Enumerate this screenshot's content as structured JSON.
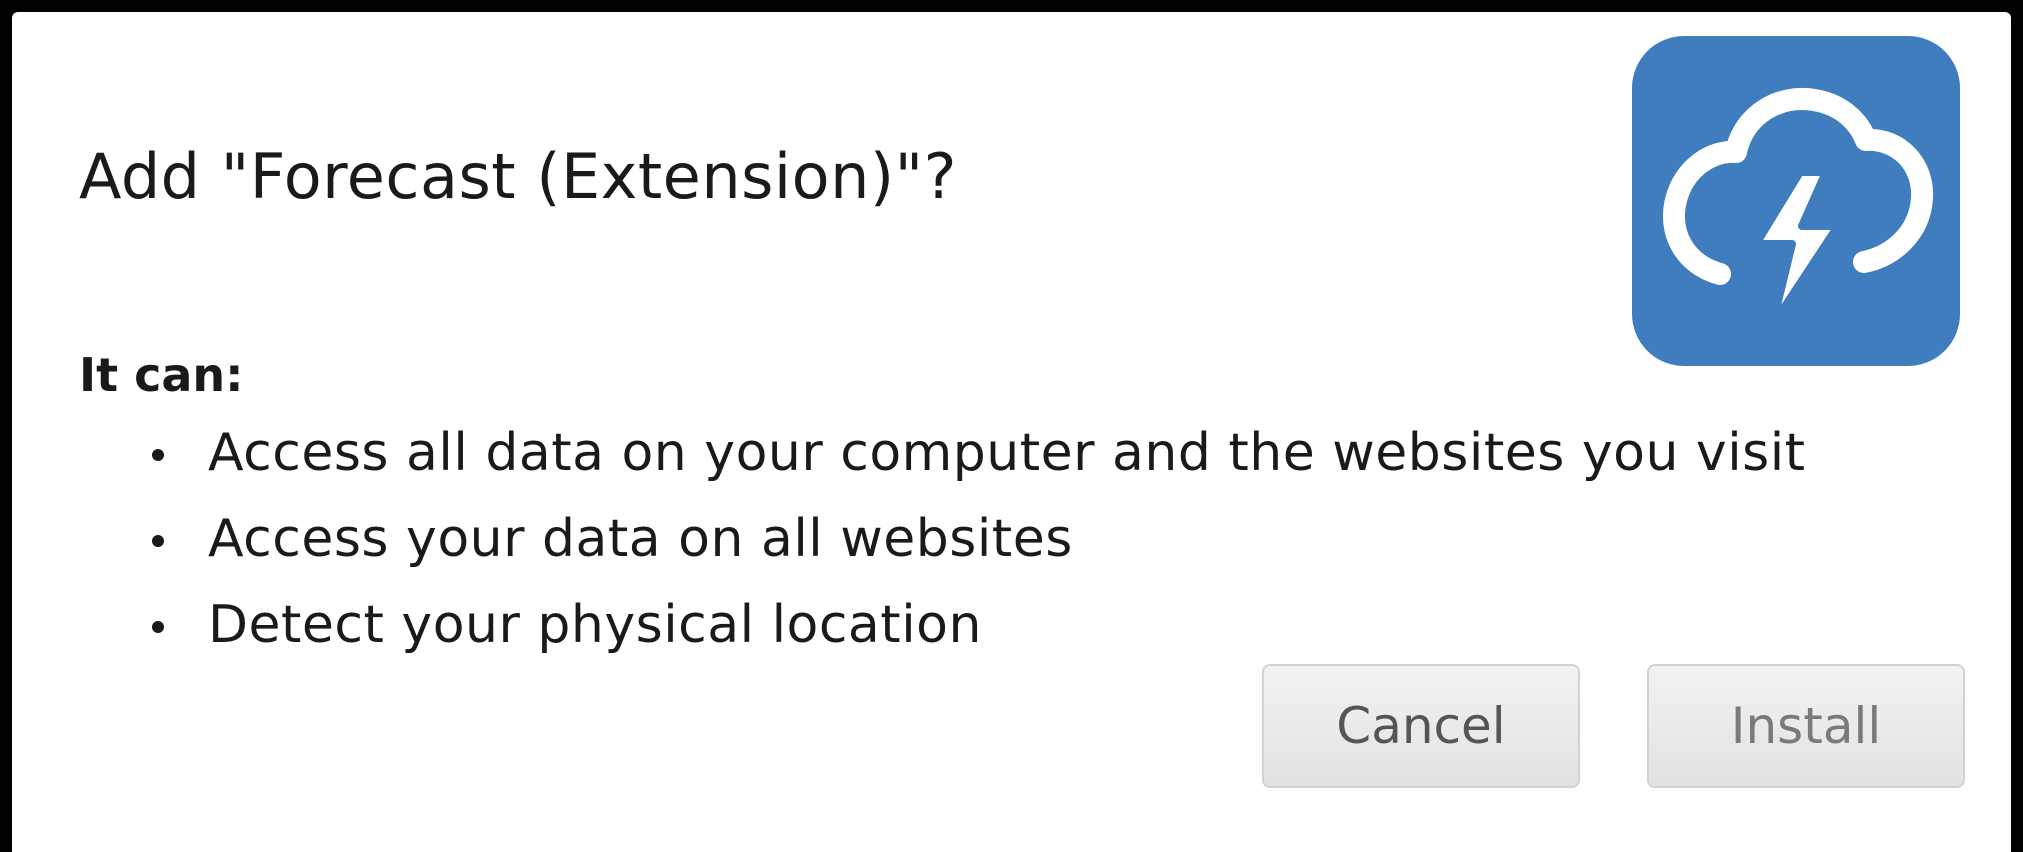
{
  "dialog": {
    "title": "Add \"Forecast (Extension)\"?",
    "can_label": "It can:",
    "permissions": [
      "Access all data on your computer and the websites you visit",
      "Access your data on all websites",
      "Detect your physical location"
    ],
    "buttons": {
      "cancel_label": "Cancel",
      "install_label": "Install"
    },
    "icon": {
      "name": "cloud-lightning-icon",
      "background_color": "#3f7dbf"
    }
  }
}
